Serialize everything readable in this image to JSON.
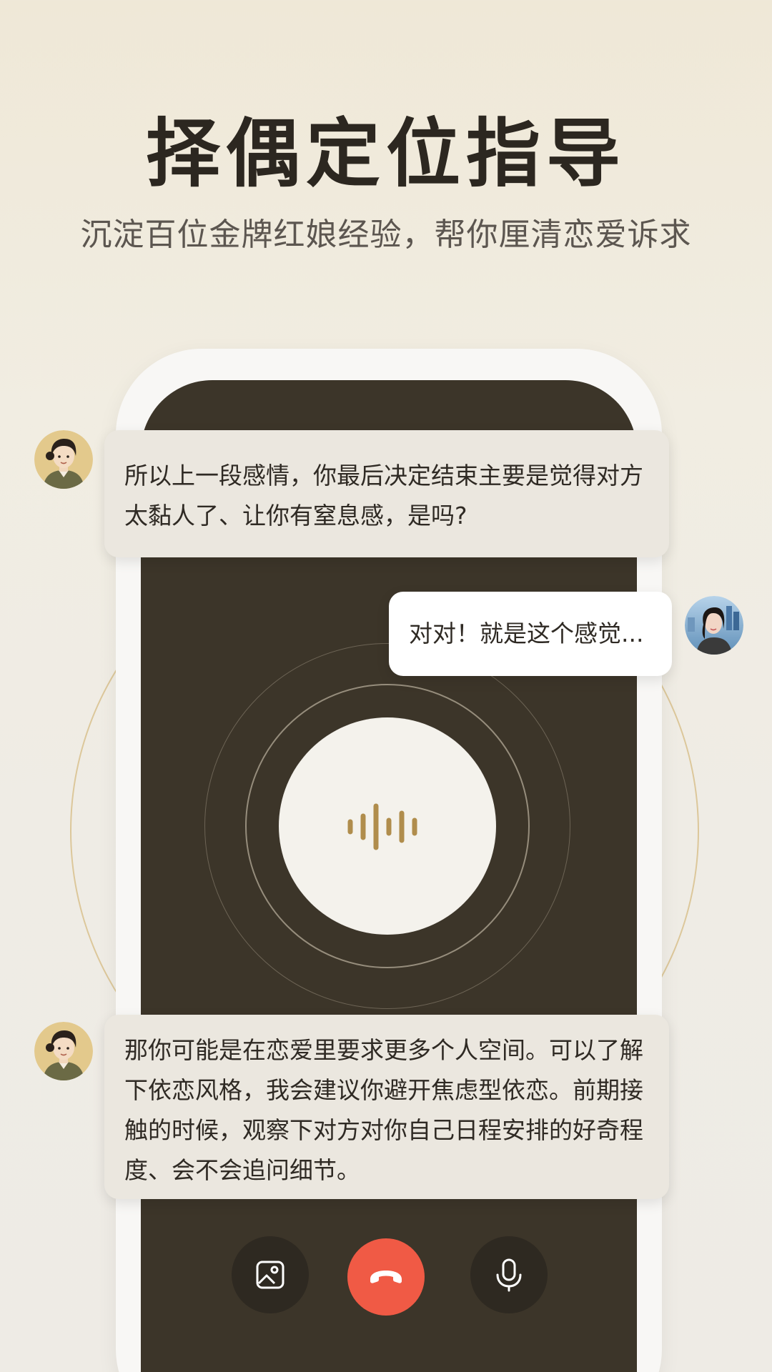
{
  "header": {
    "title": "择偶定位指导",
    "subtitle": "沉淀百位金牌红娘经验，帮你厘清恋爱诉求"
  },
  "conversation": {
    "messages": [
      {
        "role": "ai",
        "text": "所以上一段感情，你最后决定结束主要是觉得对方太黏人了、让你有窒息感，是吗?"
      },
      {
        "role": "user",
        "text": "对对！就是这个感觉..."
      },
      {
        "role": "ai",
        "text": "那你可能是在恋爱里要求更多个人空间。可以了解下依恋风格，我会建议你避开焦虑型依恋。前期接触的时候，观察下对方对你自己日程安排的好奇程度、会不会追问细节。"
      }
    ]
  },
  "call_controls": {
    "left_icon": "image-icon",
    "center_icon": "hang-up-icon",
    "right_icon": "microphone-icon"
  },
  "colors": {
    "screen_bg": "#3c3529",
    "accent_gold": "#b08d4c",
    "hangup_red": "#f05a45",
    "ai_bubble": "#ebe7df",
    "user_bubble": "#ffffff"
  }
}
